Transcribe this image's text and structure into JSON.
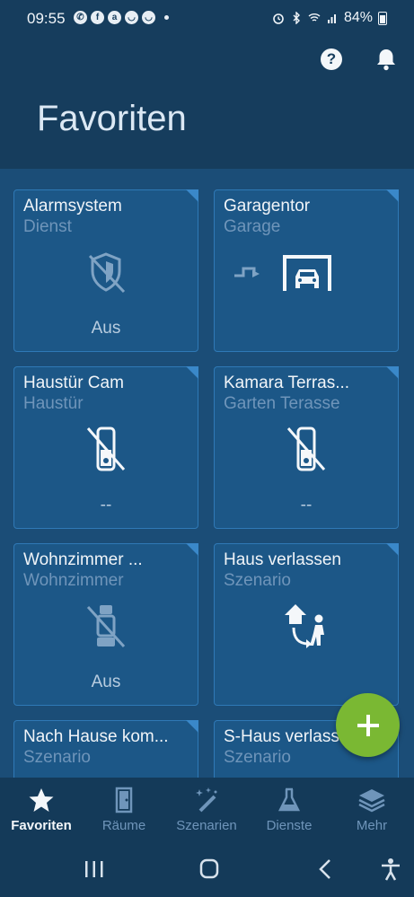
{
  "status_bar": {
    "time": "09:55",
    "notification_apps": [
      "whatsapp-icon",
      "facebook-icon",
      "amazon-icon",
      "app-icon",
      "app-icon"
    ],
    "battery": "84%"
  },
  "header": {
    "title": "Favoriten",
    "help_icon": "help-icon",
    "notifications_icon": "bell-icon"
  },
  "tiles": [
    {
      "title": "Alarmsystem",
      "subtitle": "Dienst",
      "status": "Aus",
      "icon": "shield-off-icon"
    },
    {
      "title": "Garagentor",
      "subtitle": "Garage",
      "status": "",
      "icon": "garage-icon"
    },
    {
      "title": "Haustür Cam",
      "subtitle": "Haustür",
      "status": "--",
      "icon": "camera-off-icon"
    },
    {
      "title": "Kamara Terras...",
      "subtitle": "Garten Terasse",
      "status": "--",
      "icon": "camera-off-icon"
    },
    {
      "title": "Wohnzimmer ...",
      "subtitle": "Wohnzimmer",
      "status": "Aus",
      "icon": "camera-off-icon"
    },
    {
      "title": "Haus verlassen",
      "subtitle": "Szenario",
      "status": "",
      "icon": "leave-home-icon"
    },
    {
      "title": "Nach Hause kom...",
      "subtitle": "Szenario",
      "status": "",
      "icon": ""
    },
    {
      "title": "S-Haus verlassen",
      "subtitle": "Szenario",
      "status": "",
      "icon": ""
    }
  ],
  "fab": {
    "icon": "plus-icon"
  },
  "bottom_nav": [
    {
      "label": "Favoriten",
      "icon": "star-icon",
      "active": true
    },
    {
      "label": "Räume",
      "icon": "door-icon",
      "active": false
    },
    {
      "label": "Szenarien",
      "icon": "magic-wand-icon",
      "active": false
    },
    {
      "label": "Dienste",
      "icon": "flask-icon",
      "active": false
    },
    {
      "label": "Mehr",
      "icon": "layers-icon",
      "active": false
    }
  ],
  "colors": {
    "header_bg": "#163d5d",
    "content_bg": "#1b4d77",
    "tile_bg": "#1c5787",
    "tile_border": "#2f79b6",
    "fab": "#7ab833",
    "subtitle": "#6f95ba"
  }
}
